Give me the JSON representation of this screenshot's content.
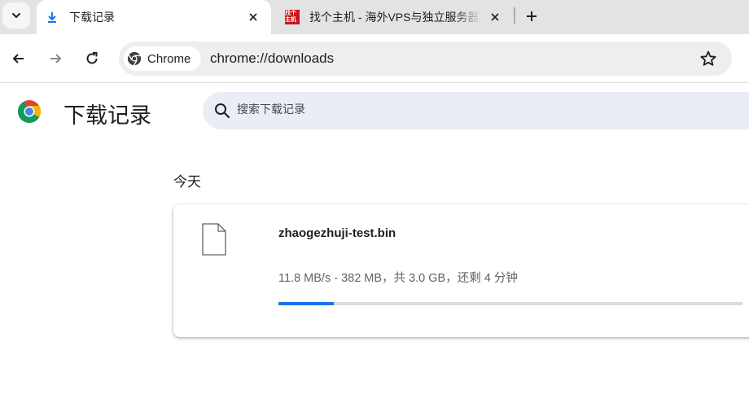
{
  "tabs": [
    {
      "title": "下载记录",
      "icon": "download-icon",
      "active": true
    },
    {
      "title": "找个主机 - 海外VPS与独立服务器",
      "icon": "zhaogezhuji-favicon",
      "active": false
    }
  ],
  "favicon_text": "找个主机",
  "toolbar": {
    "chip_label": "Chrome",
    "url": "chrome://downloads"
  },
  "page": {
    "title": "下载记录",
    "search_placeholder": "搜索下载记录"
  },
  "downloads": {
    "date_header": "今天",
    "items": [
      {
        "file_name": "zhaogezhuji-test.bin",
        "status": "11.8 MB/s - 382 MB，共 3.0 GB，还剩 4 分钟",
        "progress": 0.12
      }
    ]
  },
  "colors": {
    "accent": "#1a73e8",
    "tabstrip": "#e3e3e3",
    "search_bg": "#e9edf6",
    "favicon_red": "#c8151b"
  }
}
